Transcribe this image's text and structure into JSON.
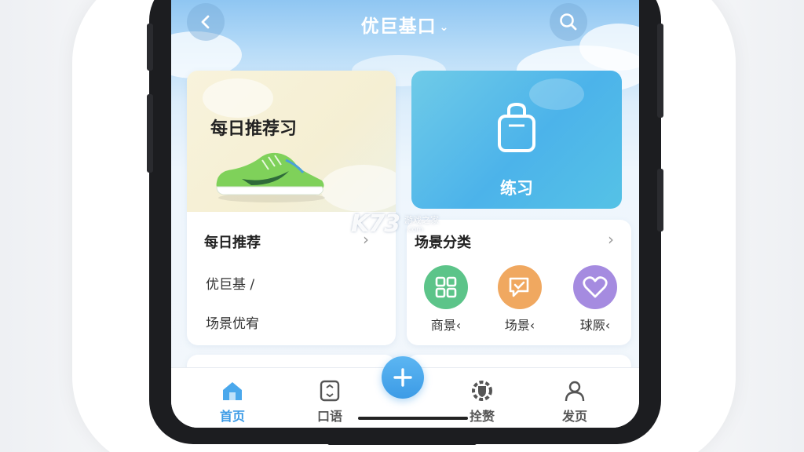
{
  "header": {
    "title": "优巨基口",
    "back_icon": "chevron-left-icon",
    "search_icon": "search-icon"
  },
  "hero": {
    "title": "每日推荐习"
  },
  "practice": {
    "label": "练习",
    "icon": "bag-icon"
  },
  "daily": {
    "title": "每日推荐",
    "items": [
      "优巨基 /",
      "场景优宥"
    ]
  },
  "scenes": {
    "title": "场景分类",
    "categories": [
      {
        "label": "商景‹",
        "icon": "grid-icon",
        "color": "#5cc489"
      },
      {
        "label": "场景‹",
        "icon": "chat-check-icon",
        "color": "#f0a860"
      },
      {
        "label": "球厥‹",
        "icon": "heart-icon",
        "color": "#a58be0"
      }
    ]
  },
  "tabbar": {
    "tabs": [
      {
        "label": "首页",
        "icon": "home-icon",
        "active": true
      },
      {
        "label": "口语",
        "icon": "document-icon",
        "active": false
      },
      {
        "label": "拴赘",
        "icon": "gear-shield-icon",
        "active": false
      },
      {
        "label": "发页",
        "icon": "user-icon",
        "active": false
      }
    ],
    "fab_icon": "plus-icon"
  },
  "watermark": {
    "brand": "K73",
    "site_name": "游戏之家",
    "domain": ".com"
  },
  "colors": {
    "accent": "#3b9be6",
    "practice_card": "#4cb3ea",
    "sky": "#8fc6f2"
  }
}
